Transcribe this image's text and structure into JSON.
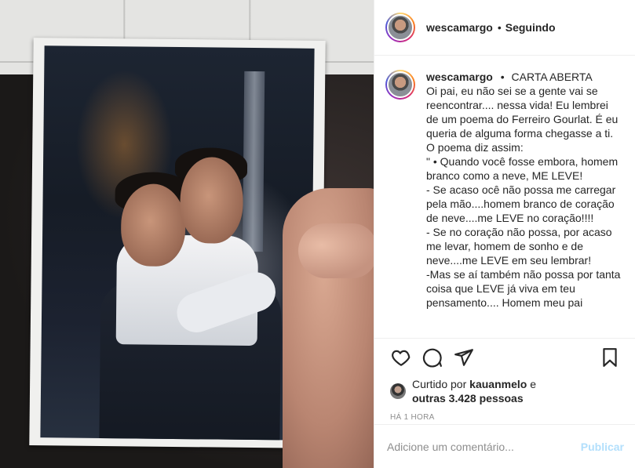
{
  "header": {
    "username": "wescamargo",
    "separator": "•",
    "follow_status": "Seguindo"
  },
  "caption": {
    "username": "wescamargo",
    "separator": "•",
    "title": "CARTA ABERTA",
    "text": "Oi pai, eu não sei se a gente vai se reencontrar.... nessa vida! Eu lembrei de um poema do Ferreiro Gourlat. É eu queria de alguma forma chegasse a ti.\nO poema diz assim:\n\" • Quando você fosse embora, homem branco como a neve, ME LEVE!\n- Se acaso ocê não possa me carregar pela mão....homem branco de coração de neve....me LEVE no coração!!!!\n- Se no coração não possa, por acaso me levar, homem de sonho e de neve....me LEVE em seu lembrar!\n-Mas se aí também não possa por tanta coisa que LEVE já viva em teu pensamento.... Homem meu pai"
  },
  "likes": {
    "prefix": "Curtido por",
    "user": "kauanmelo",
    "conjunction": "e",
    "others": "outras 3.428 pessoas"
  },
  "timestamp": "HÁ 1 HORA",
  "comment": {
    "placeholder": "Adicione um comentário...",
    "publish_label": "Publicar"
  },
  "icons": {
    "like": "heart-icon",
    "comment": "comment-icon",
    "share": "share-icon",
    "save": "bookmark-icon"
  },
  "colors": {
    "publish_disabled": "#b2dffc",
    "muted_text": "#8e8e8e",
    "divider": "#efefef"
  }
}
